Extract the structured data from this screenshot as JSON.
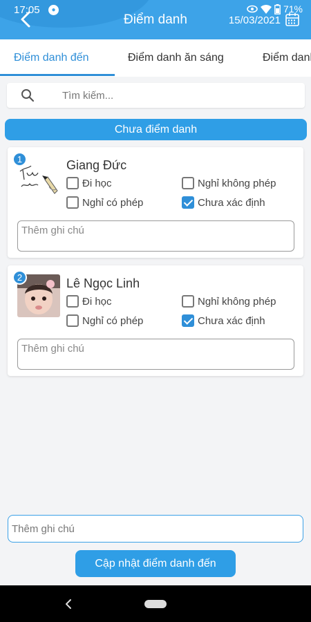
{
  "status_bar": {
    "time": "17:05",
    "battery": "71%"
  },
  "header": {
    "title": "Điểm danh",
    "date": "15/03/2021"
  },
  "tabs": [
    {
      "label": "Điểm danh đến",
      "active": true
    },
    {
      "label": "Điểm danh ăn sáng",
      "active": false
    },
    {
      "label": "Điểm danh",
      "active": false
    }
  ],
  "search": {
    "placeholder": "Tìm kiếm..."
  },
  "section_label": "Chưa điểm danh",
  "students": [
    {
      "index": "1",
      "name": "Giang Đức",
      "options": [
        {
          "label": "Đi học",
          "checked": false
        },
        {
          "label": "Nghỉ không phép",
          "checked": false
        },
        {
          "label": "Nghỉ có phép",
          "checked": false
        },
        {
          "label": "Chưa xác định",
          "checked": true
        }
      ],
      "note_placeholder": "Thêm ghi chú"
    },
    {
      "index": "2",
      "name": "Lê Ngọc Linh",
      "options": [
        {
          "label": "Đi học",
          "checked": false
        },
        {
          "label": "Nghỉ không phép",
          "checked": false
        },
        {
          "label": "Nghỉ có phép",
          "checked": false
        },
        {
          "label": "Chưa xác định",
          "checked": true
        }
      ],
      "note_placeholder": "Thêm ghi chú"
    }
  ],
  "bottom": {
    "note_placeholder": "Thêm ghi chú",
    "submit_label": "Cập nhật điểm danh đến"
  },
  "colors": {
    "primary": "#3da3e8",
    "accent": "#2f8fd8",
    "background": "#f3f4f6"
  },
  "icons": [
    "back-arrow-icon",
    "calendar-icon",
    "search-icon",
    "checkbox-icon",
    "nav-back-icon",
    "nav-home-icon"
  ]
}
